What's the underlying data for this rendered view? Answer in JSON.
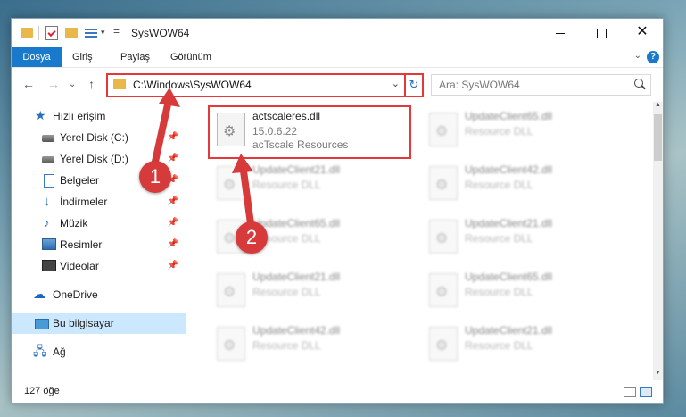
{
  "window": {
    "title": "SysWOW64",
    "minimize": "—",
    "maximize": "☐",
    "close": "✕"
  },
  "ribbon": {
    "tabs": [
      "Dosya",
      "Giriş",
      "Paylaş",
      "Görünüm"
    ],
    "help": "?"
  },
  "address": {
    "path": "C:\\Windows\\SysWOW64",
    "search_placeholder": "Ara: SysWOW64"
  },
  "sidebar": {
    "items": [
      {
        "label": "Hızlı erişim",
        "icon": "star-icon"
      },
      {
        "label": "Yerel Disk (C:)",
        "icon": "disk-icon",
        "pinned": true
      },
      {
        "label": "Yerel Disk (D:)",
        "icon": "disk-icon",
        "pinned": true
      },
      {
        "label": "Belgeler",
        "icon": "document-icon",
        "pinned": true
      },
      {
        "label": "İndirmeler",
        "icon": "download-icon",
        "pinned": true
      },
      {
        "label": "Müzik",
        "icon": "music-icon",
        "pinned": true
      },
      {
        "label": "Resimler",
        "icon": "pictures-icon",
        "pinned": true
      },
      {
        "label": "Videolar",
        "icon": "videos-icon",
        "pinned": true
      },
      {
        "label": "OneDrive",
        "icon": "cloud-icon"
      },
      {
        "label": "Bu bilgisayar",
        "icon": "computer-icon",
        "selected": true
      },
      {
        "label": "Ağ",
        "icon": "network-icon"
      }
    ]
  },
  "files": [
    {
      "name": "actscaleres.dll",
      "version": "15.0.6.22",
      "description": "acTscale Resources",
      "focused": true
    },
    {
      "name": "UpdateClient65.dll",
      "description": "Resource DLL"
    },
    {
      "name": "UpdateClient21.dll",
      "description": "Resource DLL"
    },
    {
      "name": "UpdateClient42.dll",
      "description": "Resource DLL"
    },
    {
      "name": "UpdateClient65.dll",
      "description": "Resource DLL"
    },
    {
      "name": "UpdateClient21.dll",
      "description": "Resource DLL"
    },
    {
      "name": "UpdateClient21.dll",
      "description": "Resource DLL"
    },
    {
      "name": "UpdateClient65.dll",
      "description": "Resource DLL"
    },
    {
      "name": "UpdateClient42.dll",
      "description": "Resource DLL"
    },
    {
      "name": "UpdateClient21.dll",
      "description": "Resource DLL"
    }
  ],
  "status": {
    "item_count": "127 öğe"
  },
  "annotations": {
    "step1": "1",
    "step2": "2",
    "color": "#d63a3a"
  }
}
